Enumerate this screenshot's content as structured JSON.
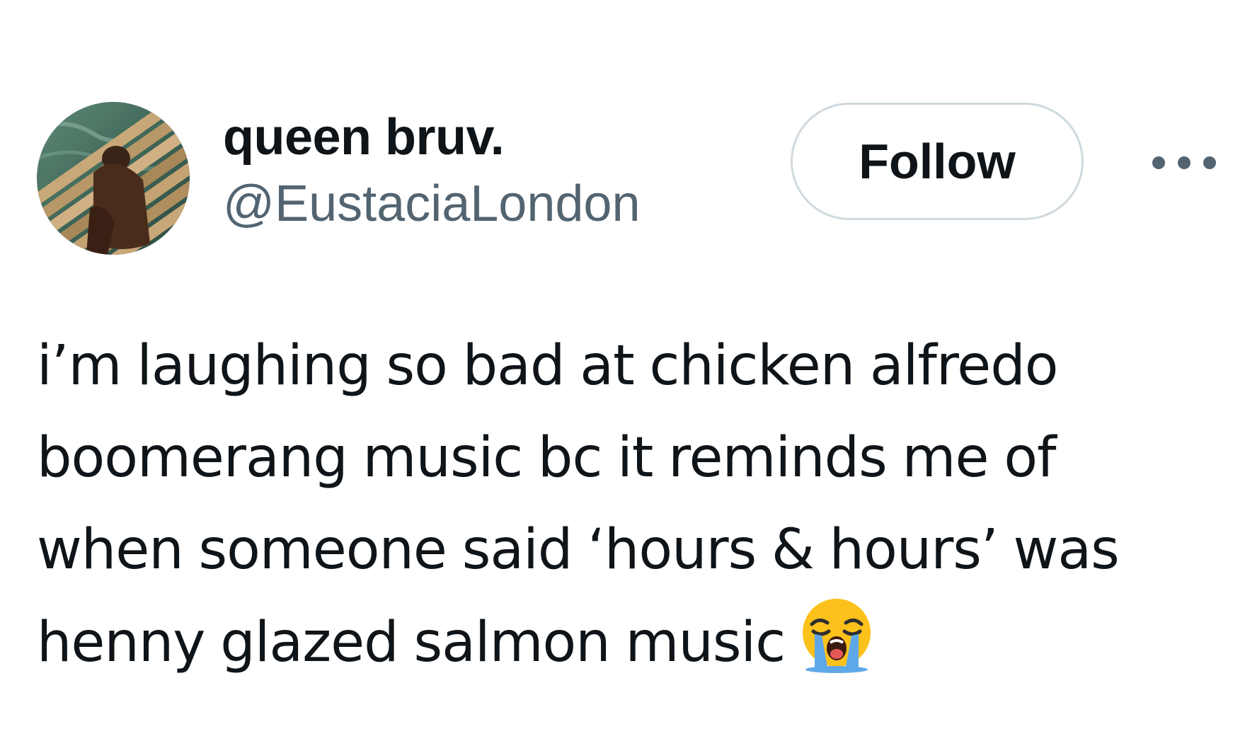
{
  "author": {
    "display_name": "queen bruv.",
    "handle": "@EustaciaLondon"
  },
  "actions": {
    "follow_label": "Follow",
    "more_icon": "more-horizontal-icon"
  },
  "tweet": {
    "lines": [
      "i’m laughing so bad at chicken alfredo",
      "boomerang music bc it reminds me of",
      "when someone said ‘hours & hours’ was",
      "henny glazed salmon music"
    ],
    "emoji": "loudly-crying-face"
  },
  "colors": {
    "text_primary": "#0f1419",
    "text_secondary": "#536471",
    "border": "#cfd9de",
    "emoji_face": "#fcc21b",
    "emoji_tears": "#5fa8e8"
  }
}
